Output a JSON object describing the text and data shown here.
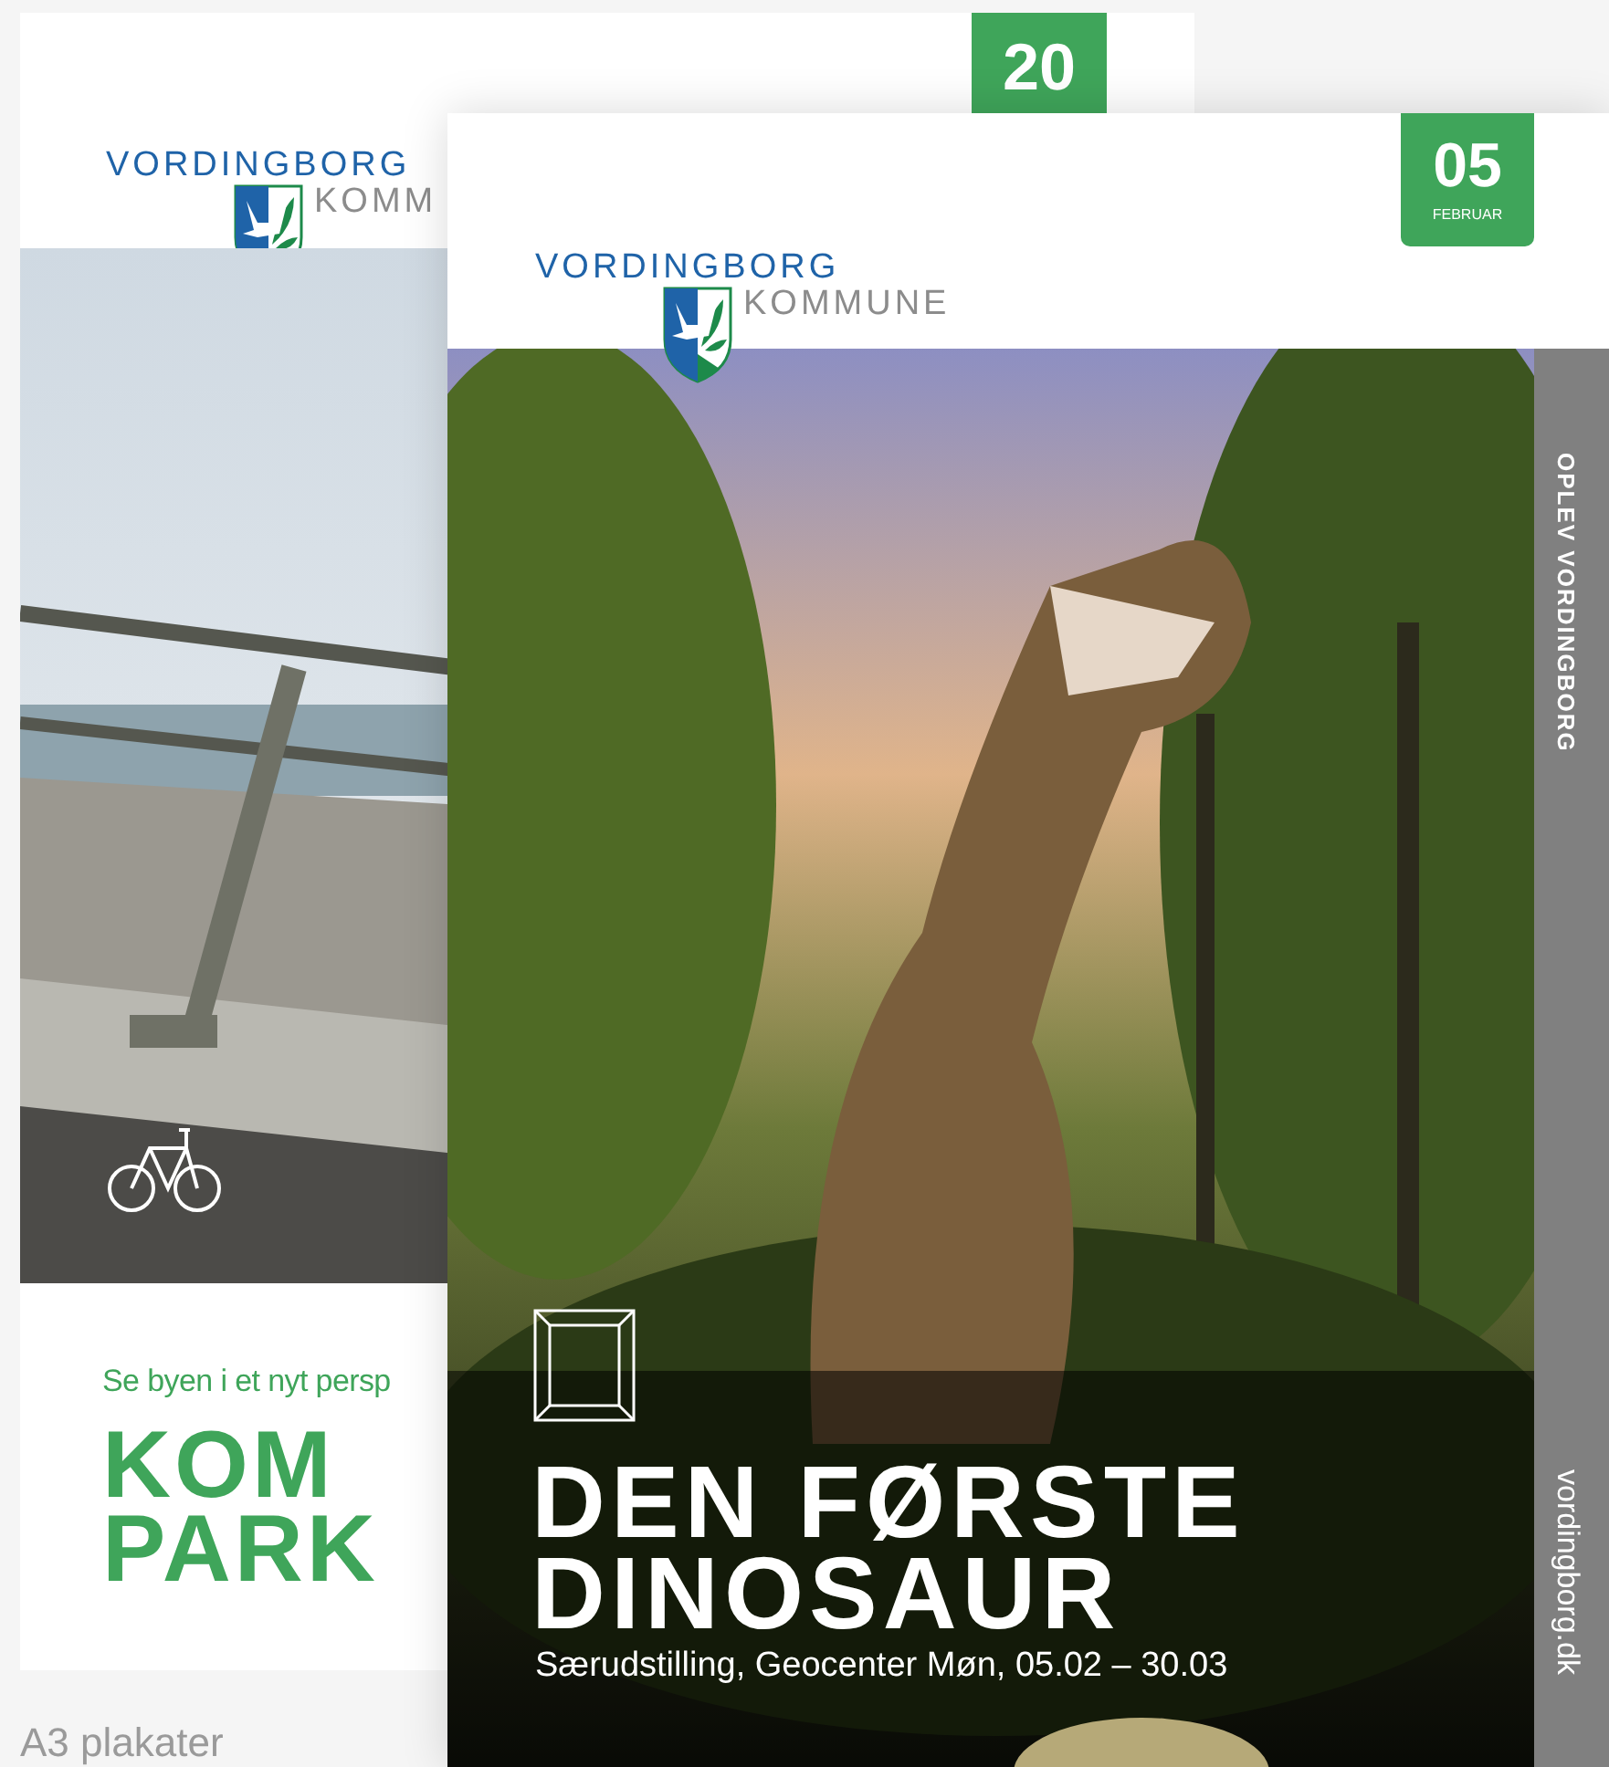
{
  "posters": [
    {
      "date": {
        "day": "20"
      },
      "logo": {
        "line1": "VORDINGBORG",
        "line2": "KOMM"
      },
      "tagline": "Se byen i et nyt persp",
      "title_lines": [
        "KOM",
        "PARK"
      ]
    },
    {
      "date": {
        "day": "05",
        "month": "FEBRUAR"
      },
      "logo": {
        "line1": "VORDINGBORG",
        "line2": "KOMMUNE"
      },
      "side_strip": {
        "top": "OPLEV VORDINGBORG",
        "bottom": "vordingborg.dk"
      },
      "title_lines": [
        "DEN FØRSTE",
        "DINOSAUR"
      ],
      "subtitle": "Særudstilling, Geocenter Møn, 05.02 – 30.03"
    }
  ],
  "caption": "A3 plakater"
}
